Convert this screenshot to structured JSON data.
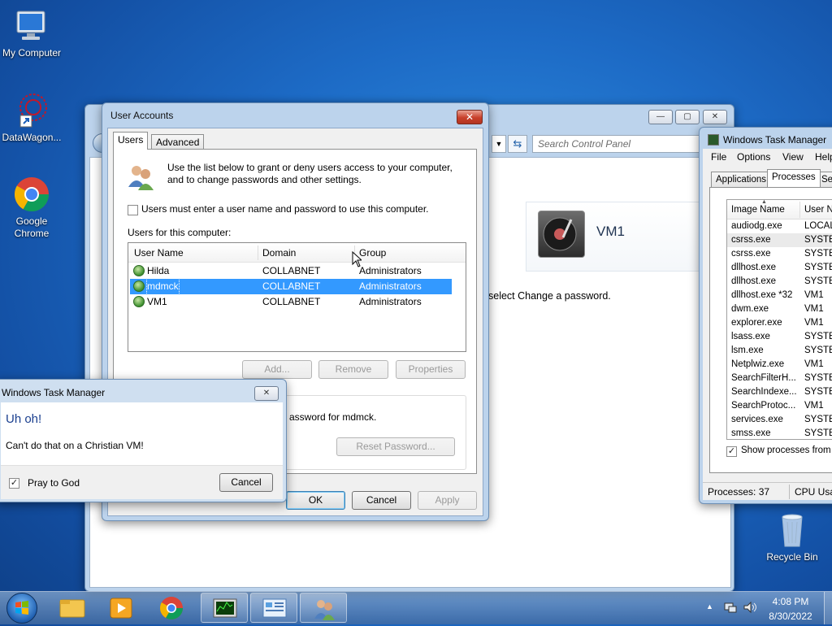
{
  "desktop": {
    "icons": [
      {
        "label": "My Computer"
      },
      {
        "label": "DataWagon..."
      },
      {
        "label": "Google Chrome"
      },
      {
        "label": "Recycle Bin"
      }
    ]
  },
  "control_panel": {
    "search_placeholder": "Search Control Panel",
    "account_name": "VM1",
    "hint_text": "select Change a password."
  },
  "user_accounts": {
    "title": "User Accounts",
    "tabs": [
      "Users",
      "Advanced"
    ],
    "intro": "Use the list below to grant or deny users access to your computer, and to change passwords and other settings.",
    "require_login_label": "Users must enter a user name and password to use this computer.",
    "require_login_checked": false,
    "list_label": "Users for this computer:",
    "columns": [
      "User Name",
      "Domain",
      "Group"
    ],
    "rows": [
      {
        "name": "Hilda",
        "domain": "COLLABNET",
        "group": "Administrators"
      },
      {
        "name": "mdmck",
        "domain": "COLLABNET",
        "group": "Administrators"
      },
      {
        "name": "VM1",
        "domain": "COLLABNET",
        "group": "Administrators"
      }
    ],
    "add_label": "Add...",
    "remove_label": "Remove",
    "properties_label": "Properties",
    "password_text": "assword for mdmck.",
    "reset_password_label": "Reset Password...",
    "ok_label": "OK",
    "cancel_label": "Cancel",
    "apply_label": "Apply"
  },
  "task_manager_dialog": {
    "title": "Windows Task Manager",
    "heading": "Uh oh!",
    "message": "Can't do that on a Christian VM!",
    "checkbox_label": "Pray to God",
    "checkbox_checked": true,
    "cancel_label": "Cancel"
  },
  "task_manager": {
    "title": "Windows Task Manager",
    "menu": [
      "File",
      "Options",
      "View",
      "Help"
    ],
    "tabs": [
      "Applications",
      "Processes",
      "Ser"
    ],
    "columns": [
      "Image Name",
      "User Na"
    ],
    "processes": [
      {
        "name": "audiodg.exe",
        "user": "LOCAL"
      },
      {
        "name": "csrss.exe",
        "user": "SYSTEM"
      },
      {
        "name": "csrss.exe",
        "user": "SYSTEM"
      },
      {
        "name": "dllhost.exe",
        "user": "SYSTEM"
      },
      {
        "name": "dllhost.exe",
        "user": "SYSTEM"
      },
      {
        "name": "dllhost.exe *32",
        "user": "VM1"
      },
      {
        "name": "dwm.exe",
        "user": "VM1"
      },
      {
        "name": "explorer.exe",
        "user": "VM1"
      },
      {
        "name": "lsass.exe",
        "user": "SYSTEM"
      },
      {
        "name": "lsm.exe",
        "user": "SYSTEM"
      },
      {
        "name": "Netplwiz.exe",
        "user": "VM1"
      },
      {
        "name": "SearchFilterH...",
        "user": "SYSTEM"
      },
      {
        "name": "SearchIndexe...",
        "user": "SYSTEM"
      },
      {
        "name": "SearchProtoc...",
        "user": "VM1"
      },
      {
        "name": "services.exe",
        "user": "SYSTEM"
      },
      {
        "name": "smss.exe",
        "user": "SYSTEM"
      }
    ],
    "show_all_label": "Show processes from all",
    "show_all_checked": true,
    "status_processes": "Processes: 37",
    "status_cpu": "CPU Usag"
  },
  "taskbar": {
    "time": "4:08 PM",
    "date": "8/30/2022"
  }
}
